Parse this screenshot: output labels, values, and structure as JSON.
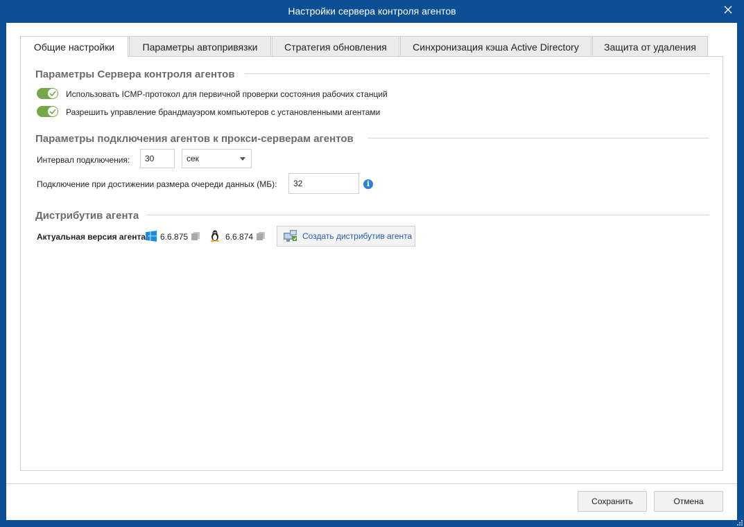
{
  "window": {
    "title": "Настройки сервера контроля агентов"
  },
  "tabs": [
    {
      "label": "Общие настройки"
    },
    {
      "label": "Параметры автопривязки"
    },
    {
      "label": "Стратегия обновления"
    },
    {
      "label": "Синхронизация кэша Active Directory"
    },
    {
      "label": "Защита от удаления"
    }
  ],
  "section_server": {
    "title": "Параметры Сервера контроля агентов",
    "icmp_label": "Использовать ICMP-протокол для первичной проверки состояния рабочих станций",
    "icmp_enabled": true,
    "firewall_label": "Разрешить управление брандмауэром компьютеров с установленными агентами",
    "firewall_enabled": true
  },
  "section_proxy": {
    "title": "Параметры подключения агентов к прокси-серверам агентов",
    "interval_label": "Интервал подключения:",
    "interval_value": "30",
    "interval_unit": "сек",
    "queue_label": "Подключение при достижении размера очереди данных (МБ):",
    "queue_value": "32"
  },
  "section_dist": {
    "title": "Дистрибутив агента",
    "version_label": "Актуальная версия агента:",
    "windows_version": "6.6.875",
    "linux_version": "6.6.874",
    "create_label": "Создать дистрибутив агента"
  },
  "footer": {
    "save_label": "Сохранить",
    "cancel_label": "Отмена"
  },
  "colors": {
    "titlebar": "#0d4f94",
    "toggle_on": "#76a74a",
    "link": "#1f5fb0",
    "info": "#2e7fd6"
  },
  "icons": [
    "close-icon",
    "windows-icon",
    "linux-icon",
    "copy-icon",
    "info-icon",
    "create-distribution-icon",
    "resize-grip-icon"
  ]
}
